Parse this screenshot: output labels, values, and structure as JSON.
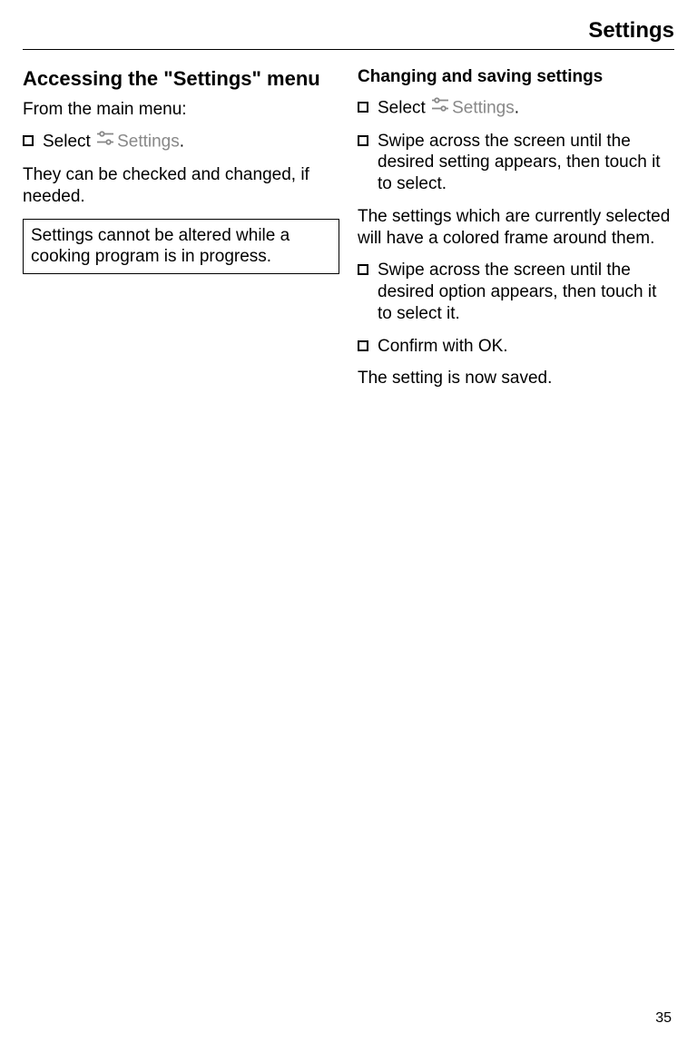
{
  "header": {
    "title": "Settings"
  },
  "left": {
    "heading": "Accessing the \"Settings\" menu",
    "intro": "From the main menu:",
    "select_prefix": "Select ",
    "settings_label": "Settings",
    "select_suffix": ".",
    "checked_text": "They can be checked and changed, if needed.",
    "note": "Settings cannot be altered while a cooking program is in progress."
  },
  "right": {
    "heading": "Changing and saving settings",
    "select_prefix": "Select ",
    "settings_label": "Settings",
    "select_suffix": ".",
    "step_swipe_setting": "Swipe across the screen until the desired setting appears, then touch it to select.",
    "frame_text": "The settings which are currently selected will have a colored frame around them.",
    "step_swipe_option": "Swipe across the screen until the desired option appears, then touch it to select it.",
    "step_confirm": "Confirm with OK.",
    "saved_text": "The setting is now saved."
  },
  "page_number": "35"
}
